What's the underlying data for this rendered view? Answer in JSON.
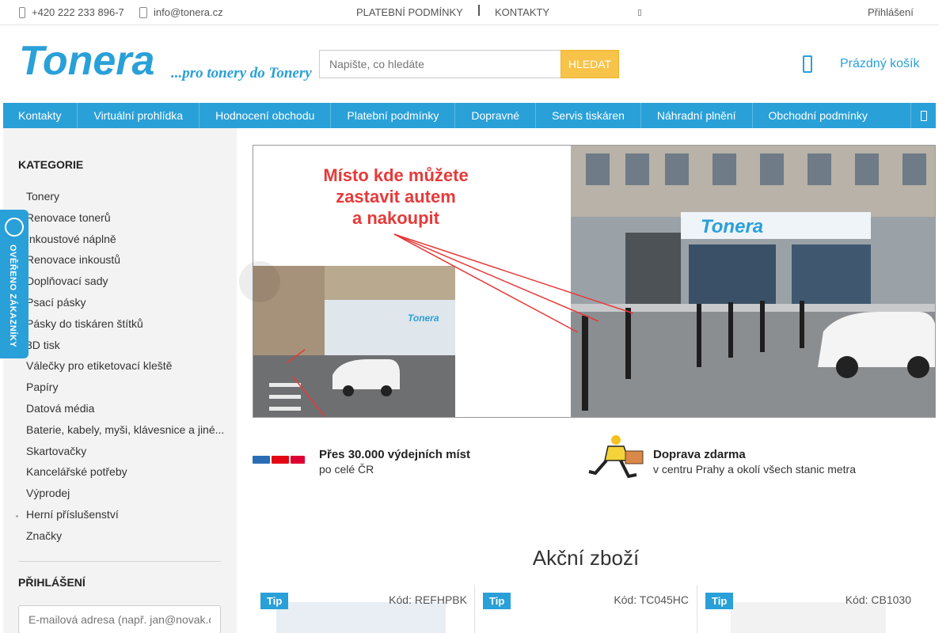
{
  "topbar": {
    "phone": "+420 222 233 896-7",
    "email": "info@tonera.cz",
    "links": [
      "PLATEBNÍ PODMÍNKY",
      "KONTAKTY"
    ],
    "login": "Přihlášení"
  },
  "header": {
    "logo_text": "Tonera",
    "logo_slogan": "...pro tonery do Tonery",
    "search_placeholder": "Napište, co hledáte",
    "search_button": "HLEDAT",
    "cart_label": "Prázdný košík"
  },
  "nav": {
    "items": [
      "Kontakty",
      "Virtuální prohlídka",
      "Hodnocení obchodu",
      "Platební podmínky",
      "Dopravné",
      "Servis tiskáren",
      "Náhradní plnění",
      "Obchodní podmínky"
    ]
  },
  "sidebar": {
    "categories_title": "KATEGORIE",
    "categories": [
      "Tonery",
      "Renovace tonerů",
      "Inkoustové náplně",
      "Renovace inkoustů",
      "Doplňovací sady",
      "Psací pásky",
      "Pásky do tiskáren štítků",
      "3D tisk",
      "Válečky pro etiketovací kleště",
      "Papíry",
      "Datová média",
      "Baterie, kabely, myši, klávesnice a jiné...",
      "Skartovačky",
      "Kancelářské potřeby",
      "Výprodej",
      "Herní příslušenství",
      "Značky"
    ],
    "login_title": "PŘIHLÁŠENÍ",
    "email_placeholder": "E-mailová adresa (např. jan@novak.cz)"
  },
  "verified_badge": "OVĚŘENO ZÁKAZNÍKY",
  "banner": {
    "caption_lines": [
      "Místo kde můžete",
      "zastavit autem",
      "a nakoupit"
    ]
  },
  "benefits": [
    {
      "title": "Přes 30.000 výdejních míst",
      "subtitle": "po celé ČR"
    },
    {
      "title": "Doprava zdarma",
      "subtitle": "v centru Prahy a okolí všech stanic metra"
    }
  ],
  "products_section": {
    "title": "Akční zboží",
    "items": [
      {
        "badge": "Tip",
        "code": "Kód: REFHPBK"
      },
      {
        "badge": "Tip",
        "code": "Kód: TC045HC"
      },
      {
        "badge": "Tip",
        "code": "Kód: CB1030"
      }
    ]
  },
  "colors": {
    "brand_blue": "#2aa0d8",
    "search_button": "#f7c348",
    "caption_red": "#e63a3a"
  }
}
